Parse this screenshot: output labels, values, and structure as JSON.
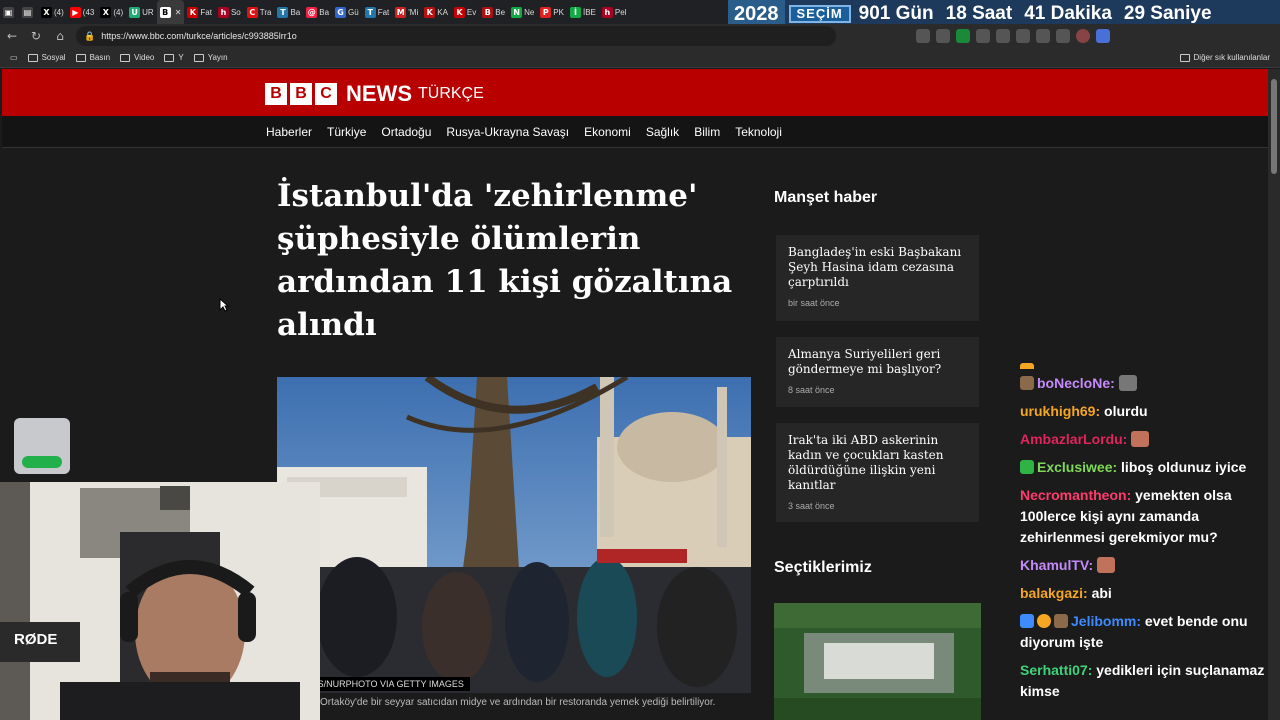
{
  "browser": {
    "tabs": [
      "(4)",
      "(43",
      "(4)",
      "UR",
      "Fat",
      "So",
      "Tra",
      "Ba",
      "Ba",
      "Gü",
      "Fat",
      "'Mi",
      "KA",
      "Ev",
      "Be",
      "Ne",
      "PK",
      "İBE",
      "Pel"
    ],
    "url": "https://www.bbc.com/turkce/articles/c993885lrr1o",
    "bookmarks": [
      "Sosyal",
      "Basın",
      "Video",
      "Y",
      "Yayın"
    ],
    "other_bookmarks": "Diğer sık kullanılanlar"
  },
  "election": {
    "year": "2028",
    "label": "SEÇİM",
    "days": "901 Gün",
    "hours": "18 Saat",
    "minutes": "41 Dakika",
    "seconds": "29 Saniye"
  },
  "bbc": {
    "logo_news": "NEWS",
    "logo_lang": "TÜRKÇE",
    "nav": [
      "Haberler",
      "Türkiye",
      "Ortadoğu",
      "Rusya-Ukrayna Savaşı",
      "Ekonomi",
      "Sağlık",
      "Bilim",
      "Teknoloji"
    ],
    "headline": "İstanbul'da 'zehirlenme' şüphesiyle ölümlerin ardından 11 kişi gözaltına alındı",
    "image_credit": "DEMIRTAS/NURPHOTO VIA GETTY IMAGES",
    "image_caption": "Ortaköy'de bir seyyar satıcıdan midye ve ardından bir restoranda yemek yediği belirtiliyor.",
    "sidebar_title": "Manşet haber",
    "cards": [
      {
        "title": "Bangladeş'in eski Başbakanı Şeyh Hasina idam cezasına çarptırıldı",
        "time": "bir saat önce"
      },
      {
        "title": "Almanya Suriyelileri geri göndermeye mi başlıyor?",
        "time": "8 saat önce"
      },
      {
        "title": "Irak'ta iki ABD askerinin kadın ve çocukları kasten öldürdüğüne ilişkin yeni kanıtlar",
        "time": "3 saat önce"
      }
    ],
    "picks_title": "Seçtiklerimiz"
  },
  "chat": [
    {
      "user": "boNecloNe:",
      "text": "",
      "color": "#c58af9"
    },
    {
      "user": "urukhigh69:",
      "text": "olurdu",
      "color": "#f5a623"
    },
    {
      "user": "AmbazlarLordu:",
      "text": "",
      "color": "#e0245e"
    },
    {
      "user": "Exclusiwee:",
      "text": "liboş oldunuz iyice",
      "color": "#7ed957"
    },
    {
      "user": "Necromantheon:",
      "text": "yemekten olsa 100lerce kişi aynı zamanda zehirlenmesi gerekmiyor mu?",
      "color": "#ff3b6b"
    },
    {
      "user": "KhamulTV:",
      "text": "",
      "color": "#c58af9"
    },
    {
      "user": "balakgazi:",
      "text": "abi",
      "color": "#f5a623"
    },
    {
      "user": "Jelibomm:",
      "text": "evet bende onu diyorum işte",
      "color": "#3d8bfd"
    },
    {
      "user": "Serhatti07:",
      "text": "yedikleri için suçlanamaz kimse",
      "color": "#3fd37a"
    }
  ],
  "webcam": {
    "mic_brand": "RØDE"
  }
}
